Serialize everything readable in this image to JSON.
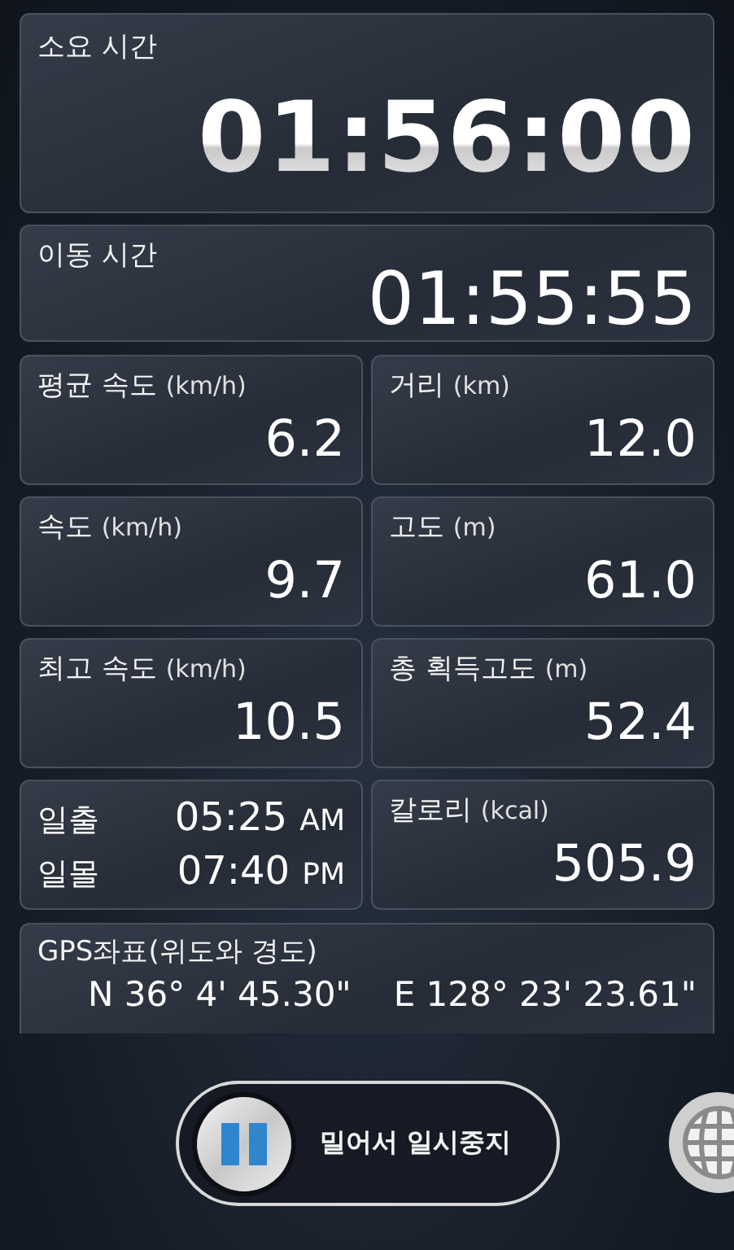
{
  "elapsed": {
    "label": "소요 시간",
    "value": "01:56:00"
  },
  "moving": {
    "label": "이동 시간",
    "value": "01:55:55"
  },
  "cells": [
    {
      "kind": "stat",
      "label": "평균 속도",
      "unit": "(km/h)",
      "value": "6.2"
    },
    {
      "kind": "stat",
      "label": "거리",
      "unit": "(km)",
      "value": "12.0"
    },
    {
      "kind": "stat",
      "label": "속도",
      "unit": "(km/h)",
      "value": "9.7"
    },
    {
      "kind": "stat",
      "label": "고도",
      "unit": "(m)",
      "value": "61.0"
    },
    {
      "kind": "stat",
      "label": "최고 속도",
      "unit": "(km/h)",
      "value": "10.5"
    },
    {
      "kind": "stat",
      "label": "총 획득고도",
      "unit": "(m)",
      "value": "52.4"
    },
    {
      "kind": "sun",
      "rows": [
        {
          "label": "일출",
          "time": "05:25",
          "period": "AM"
        },
        {
          "label": "일몰",
          "time": "07:40",
          "period": "PM"
        }
      ]
    },
    {
      "kind": "stat",
      "label": "칼로리",
      "unit": "(kcal)",
      "value": "505.9"
    }
  ],
  "gps": {
    "label": "GPS좌표(위도와 경도)",
    "latitude": "N 36° 4' 45.30\"",
    "longitude": "E 128° 23' 23.61\""
  },
  "slider": {
    "label": "밀어서 일시중지",
    "level": 0
  }
}
